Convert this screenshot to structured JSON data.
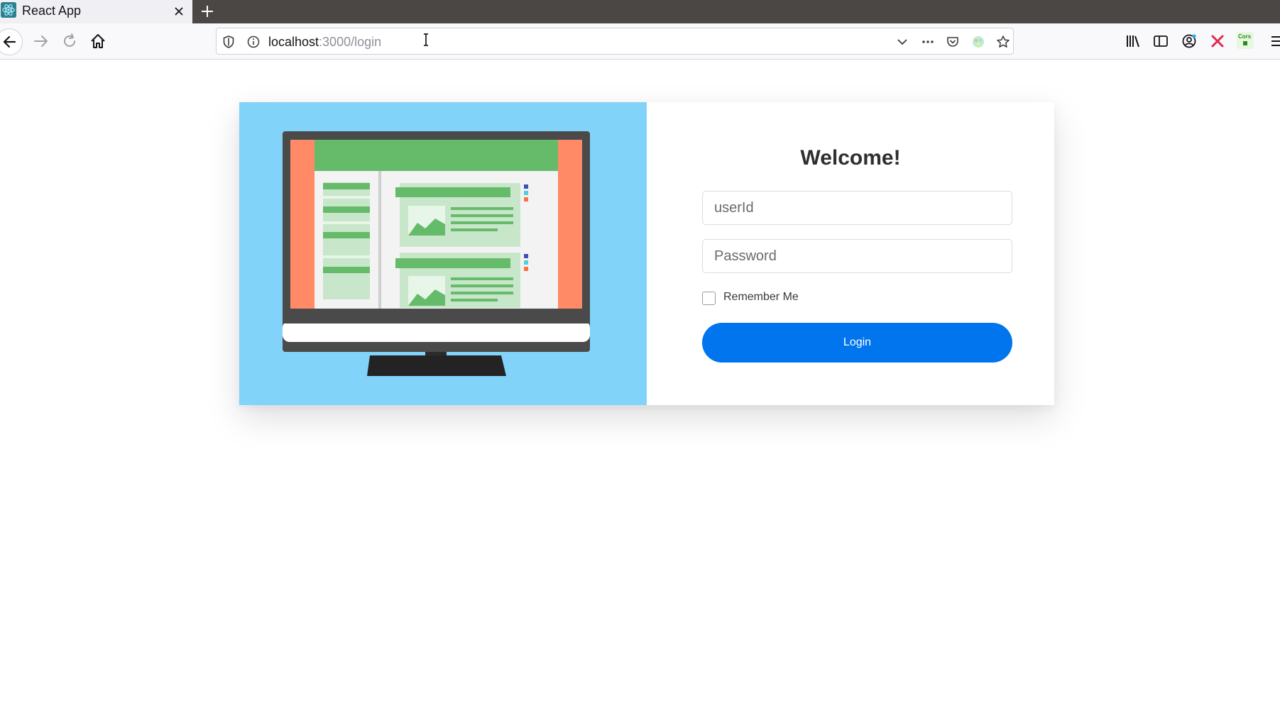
{
  "browser": {
    "tab": {
      "title": "React App",
      "favicon": "react-icon"
    },
    "url": {
      "host": "localhost",
      "path": ":3000/login"
    },
    "colors": {
      "tabbar": "#4a4744",
      "accent": "#0075ee"
    }
  },
  "login": {
    "title": "Welcome!",
    "user_placeholder": "userId",
    "password_placeholder": "Password",
    "remember_label": "Remember Me",
    "button_label": "Login"
  },
  "toolbar_ext": {
    "cors_badge": "Cors"
  },
  "theme": {
    "illustration_bg": "#82d3fa",
    "button_bg": "#0075ee"
  }
}
